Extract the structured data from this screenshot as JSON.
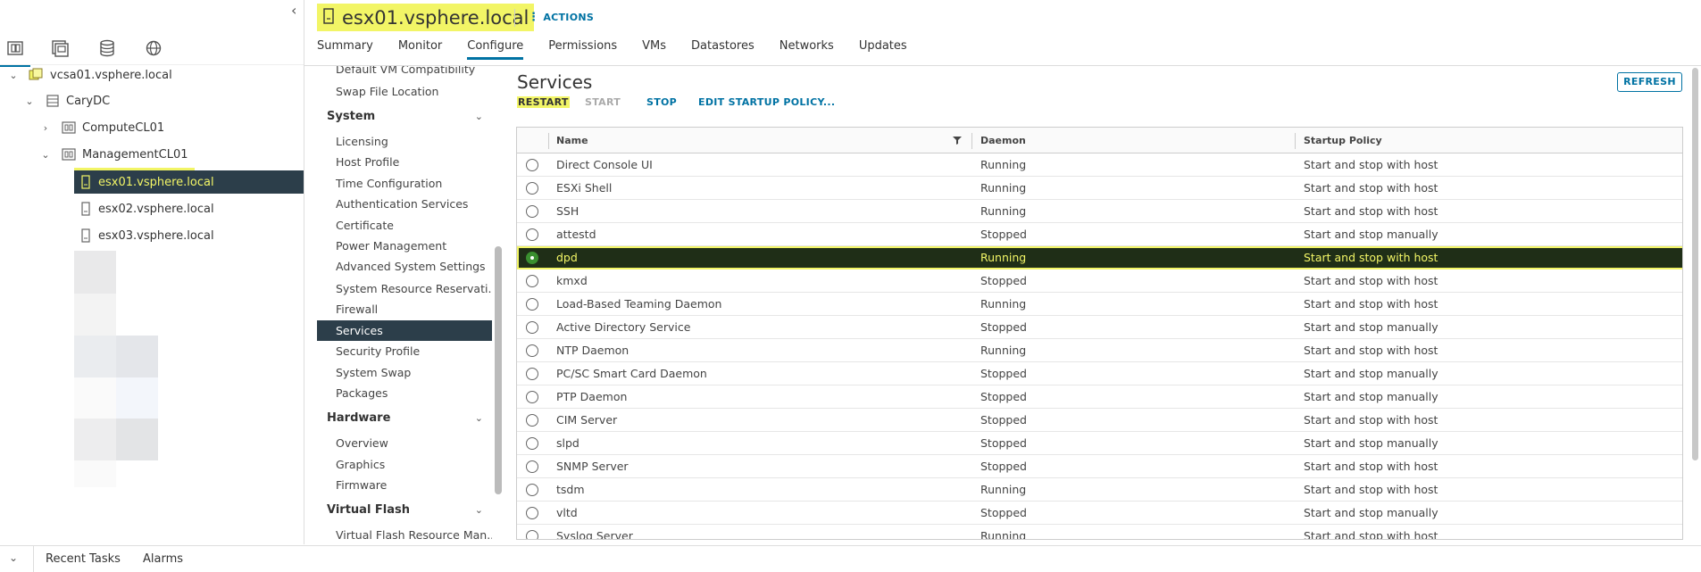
{
  "nav": {
    "collapse_icon": "chevron-left-icon",
    "view_icons": [
      "hosts-clusters-icon",
      "vms-templates-icon",
      "storage-icon",
      "networking-icon"
    ],
    "tree": [
      {
        "label": "vcsa01.vsphere.local",
        "icon": "vcenter-icon"
      },
      {
        "label": "CaryDC",
        "icon": "datacenter-icon"
      },
      {
        "label": "ComputeCL01",
        "icon": "cluster-icon"
      },
      {
        "label": "ManagementCL01",
        "icon": "cluster-icon"
      },
      {
        "label": "esx01.vsphere.local",
        "icon": "host-icon"
      },
      {
        "label": "esx02.vsphere.local",
        "icon": "host-icon"
      },
      {
        "label": "esx03.vsphere.local",
        "icon": "host-icon"
      }
    ]
  },
  "header": {
    "title": "esx01.vsphere.local",
    "actions_label": "ACTIONS",
    "tabs": [
      "Summary",
      "Monitor",
      "Configure",
      "Permissions",
      "VMs",
      "Datastores",
      "Networks",
      "Updates"
    ]
  },
  "config_menu": {
    "items_top": [
      "Default VM Compatibility",
      "Swap File Location"
    ],
    "system_label": "System",
    "system_items": [
      "Licensing",
      "Host Profile",
      "Time Configuration",
      "Authentication Services",
      "Certificate",
      "Power Management",
      "Advanced System Settings",
      "System Resource Reservati...",
      "Firewall",
      "Services",
      "Security Profile",
      "System Swap",
      "Packages"
    ],
    "hardware_label": "Hardware",
    "hardware_items": [
      "Overview",
      "Graphics",
      "Firmware"
    ],
    "vflash_label": "Virtual Flash",
    "vflash_items": [
      "Virtual Flash Resource Man..."
    ]
  },
  "services": {
    "title": "Services",
    "refresh_label": "REFRESH",
    "actions": {
      "restart": "RESTART",
      "start": "START",
      "stop": "STOP",
      "edit": "EDIT STARTUP POLICY..."
    },
    "columns": {
      "name": "Name",
      "daemon": "Daemon",
      "policy": "Startup Policy"
    },
    "rows": [
      {
        "name": "Direct Console UI",
        "daemon": "Running",
        "policy": "Start and stop with host"
      },
      {
        "name": "ESXi Shell",
        "daemon": "Running",
        "policy": "Start and stop with host"
      },
      {
        "name": "SSH",
        "daemon": "Running",
        "policy": "Start and stop with host"
      },
      {
        "name": "attestd",
        "daemon": "Stopped",
        "policy": "Start and stop manually"
      },
      {
        "name": "dpd",
        "daemon": "Running",
        "policy": "Start and stop with host"
      },
      {
        "name": "kmxd",
        "daemon": "Stopped",
        "policy": "Start and stop with host"
      },
      {
        "name": "Load-Based Teaming Daemon",
        "daemon": "Running",
        "policy": "Start and stop with host"
      },
      {
        "name": "Active Directory Service",
        "daemon": "Stopped",
        "policy": "Start and stop manually"
      },
      {
        "name": "NTP Daemon",
        "daemon": "Running",
        "policy": "Start and stop with host"
      },
      {
        "name": "PC/SC Smart Card Daemon",
        "daemon": "Stopped",
        "policy": "Start and stop manually"
      },
      {
        "name": "PTP Daemon",
        "daemon": "Stopped",
        "policy": "Start and stop manually"
      },
      {
        "name": "CIM Server",
        "daemon": "Stopped",
        "policy": "Start and stop with host"
      },
      {
        "name": "slpd",
        "daemon": "Stopped",
        "policy": "Start and stop manually"
      },
      {
        "name": "SNMP Server",
        "daemon": "Stopped",
        "policy": "Start and stop with host"
      },
      {
        "name": "tsdm",
        "daemon": "Running",
        "policy": "Start and stop with host"
      },
      {
        "name": "vltd",
        "daemon": "Stopped",
        "policy": "Start and stop manually"
      },
      {
        "name": "Syslog Server",
        "daemon": "Running",
        "policy": "Start and stop with host"
      }
    ]
  },
  "bottom": {
    "recent_tasks": "Recent Tasks",
    "alarms": "Alarms"
  },
  "colors": {
    "accent": "#0072a3",
    "highlight": "#f2f566",
    "selected_dark": "#2c3e4a",
    "selected_row": "#1f2e17"
  }
}
